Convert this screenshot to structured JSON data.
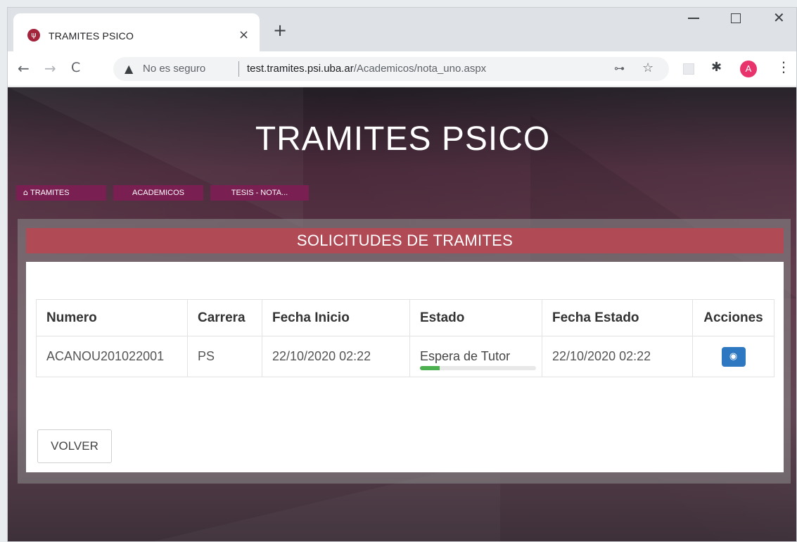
{
  "browser": {
    "tab_title": "TRAMITES PSICO",
    "tab_close": "×",
    "new_tab": "+",
    "security_label": "No es seguro",
    "url_host": "test.tramites.psi.uba.ar",
    "url_path": "/Academicos/nota_uno.aspx",
    "avatar_letter": "A"
  },
  "site": {
    "title": "TRAMITES PSICO"
  },
  "breadcrumb": [
    {
      "label": "TRAMITES"
    },
    {
      "label": "ACADEMICOS"
    },
    {
      "label": "TESIS - NOTA..."
    }
  ],
  "panel": {
    "heading": "SOLICITUDES DE TRAMITES",
    "table": {
      "headers": [
        "Numero",
        "Carrera",
        "Fecha Inicio",
        "Estado",
        "Fecha Estado",
        "Acciones"
      ],
      "rows": [
        {
          "numero": "ACANOU201022001",
          "carrera": "PS",
          "fecha_inicio": "22/10/2020 02:22",
          "estado": "Espera de Tutor",
          "estado_progress": 0.17,
          "fecha_estado": "22/10/2020 02:22"
        }
      ]
    },
    "back_button": "VOLVER"
  },
  "colors": {
    "panel_heading": "#b04a55",
    "breadcrumb_bg": "#7a1f52",
    "action_button": "#2e78c2",
    "progress_fill": "#4caf50"
  }
}
